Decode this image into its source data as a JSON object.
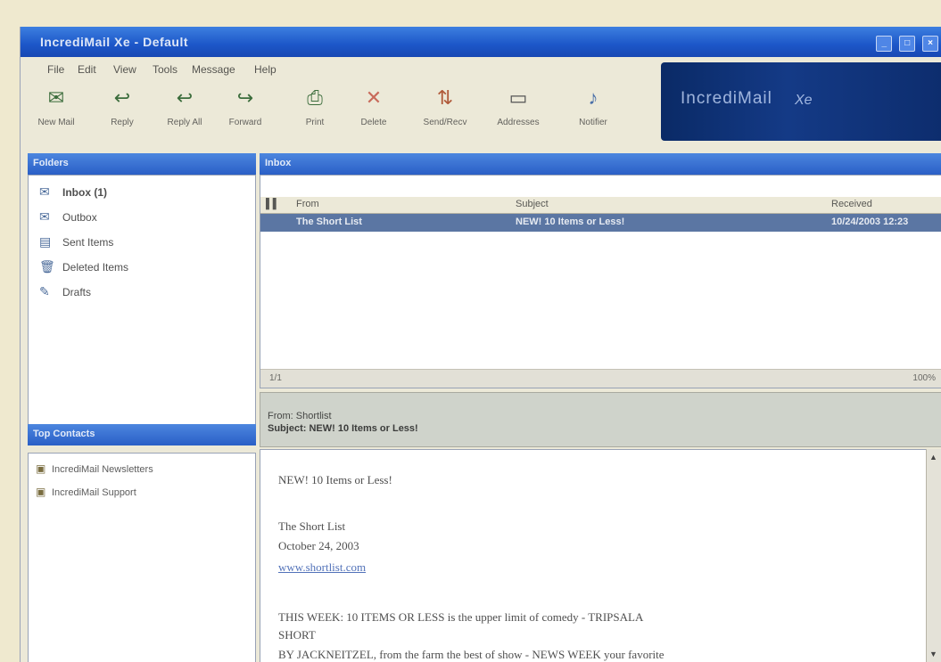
{
  "window": {
    "title": "IncrediMail Xe - Default",
    "controls": [
      "_",
      "□",
      "×"
    ]
  },
  "menu": [
    "File",
    "Edit",
    "View",
    "Tools",
    "Message",
    "Help"
  ],
  "toolbar": [
    {
      "label": "New Mail",
      "icon": "new-mail-icon",
      "glyph": "✉"
    },
    {
      "label": "Reply",
      "icon": "reply-icon",
      "glyph": "↩"
    },
    {
      "label": "Reply All",
      "icon": "reply-all-icon",
      "glyph": "↩"
    },
    {
      "label": "Forward",
      "icon": "forward-icon",
      "glyph": "↪"
    },
    {
      "label": "Print",
      "icon": "print-icon",
      "glyph": "⎙"
    },
    {
      "label": "Delete",
      "icon": "delete-icon",
      "glyph": "✕"
    },
    {
      "label": "Send/Recv",
      "icon": "send-receive-icon",
      "glyph": "⇅"
    },
    {
      "label": "Addresses",
      "icon": "addresses-icon",
      "glyph": "▭"
    },
    {
      "label": "Notifier",
      "icon": "notifier-icon",
      "glyph": "♪"
    }
  ],
  "brand": {
    "wordmark": "IncrediMail",
    "tagline": "Xe"
  },
  "folders": {
    "header": "Folders",
    "items": [
      {
        "label": "Inbox (1)",
        "icon": "inbox-icon",
        "glyph": "✉"
      },
      {
        "label": "Outbox",
        "icon": "outbox-icon",
        "glyph": "✉"
      },
      {
        "label": "Sent Items",
        "icon": "sent-items-icon",
        "glyph": "▤"
      },
      {
        "label": "Deleted Items",
        "icon": "deleted-items-icon",
        "glyph": "🗑"
      },
      {
        "label": "Drafts",
        "icon": "drafts-icon",
        "glyph": "✎"
      }
    ]
  },
  "contacts": {
    "header": "Top Contacts",
    "items": [
      "IncrediMail Newsletters",
      "IncrediMail Support"
    ]
  },
  "message_list": {
    "header": "Inbox",
    "columns": [
      "From",
      "Subject",
      "Received"
    ],
    "rows": [
      {
        "from": "The Short List",
        "subject": "NEW! 10 Items or Less!",
        "received": "10/24/2003 12:23"
      }
    ],
    "status_left": "1/1",
    "status_right": "100%"
  },
  "preview": {
    "from_line": "From: Shortlist",
    "subject_line": "Subject: NEW! 10 Items or Less!",
    "body": {
      "line1": "NEW! 10 Items or Less!",
      "line2": "The Short List",
      "line3": "October 24, 2003",
      "link": "www.shortlist.com",
      "line4": "THIS WEEK: 10 ITEMS OR LESS is the upper limit of comedy - TRIPSALA",
      "line5": "SHORT",
      "line6": "BY JACKNEITZEL, from the farm the best of show - NEWS WEEK your favorite"
    }
  }
}
